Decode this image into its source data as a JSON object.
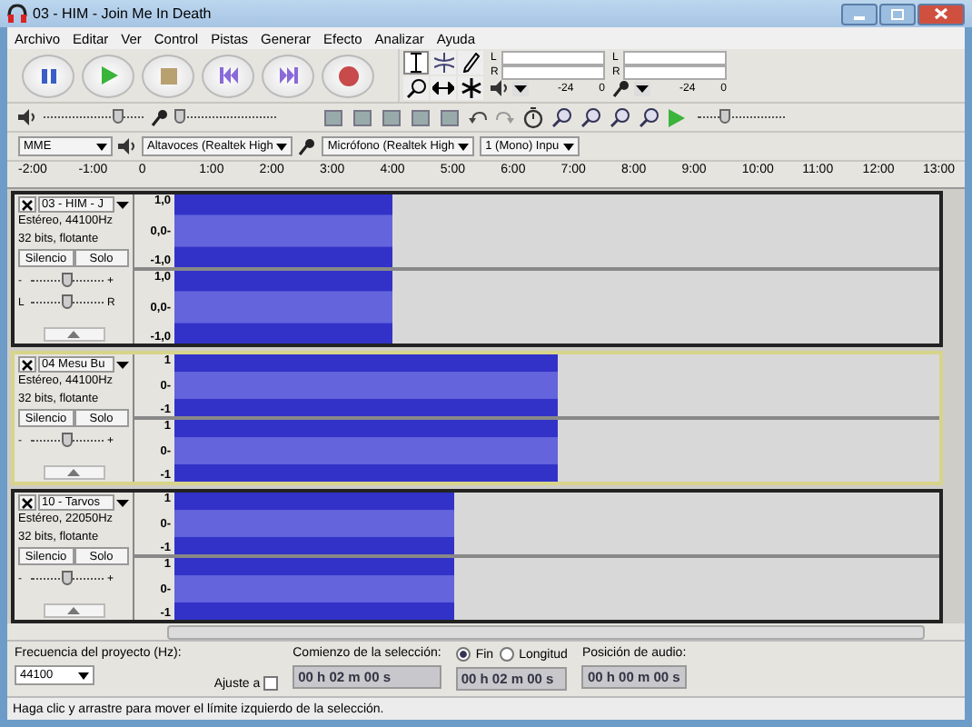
{
  "window": {
    "title": "03 - HIM - Join Me In Death"
  },
  "menu": [
    "Archivo",
    "Editar",
    "Ver",
    "Control",
    "Pistas",
    "Generar",
    "Efecto",
    "Analizar",
    "Ayuda"
  ],
  "meters": [
    {
      "channels": [
        "L",
        "R"
      ],
      "scale": [
        "-24",
        "0"
      ]
    },
    {
      "channels": [
        "L",
        "R"
      ],
      "scale": [
        "-24",
        "0"
      ]
    }
  ],
  "mixer": {
    "output": {
      "level": 0.74
    },
    "input": {
      "level": 0.04
    }
  },
  "play_speed": {
    "level": 0.32
  },
  "devices": {
    "host": "MME",
    "output": "Altavoces (Realtek High",
    "input": "Micrófono (Realtek High",
    "channels": "1 (Mono) Inpu"
  },
  "ruler": [
    "-2:00",
    "-1:00",
    "0",
    "1:00",
    "2:00",
    "3:00",
    "4:00",
    "5:00",
    "6:00",
    "7:00",
    "8:00",
    "9:00",
    "10:00",
    "11:00",
    "12:00",
    "13:00"
  ],
  "tracks": [
    {
      "name": "03 - HIM - J",
      "format": "Estéreo, 44100Hz",
      "bits": "32 bits, flotante",
      "mute": "Silencio",
      "solo": "Solo",
      "selected": false,
      "gain": {
        "labels": [
          "-",
          "+"
        ],
        "level": 0.5
      },
      "pan": {
        "labels": [
          "L",
          "R"
        ],
        "level": 0.5
      },
      "channels": [
        [
          "1,0",
          "0,0-",
          "-1,0"
        ],
        [
          "1,0",
          "0,0-",
          "-1,0"
        ]
      ]
    },
    {
      "name": "04 Mesu Bu",
      "format": "Estéreo, 44100Hz",
      "bits": "32 bits, flotante",
      "mute": "Silencio",
      "solo": "Solo",
      "selected": true,
      "gain": {
        "labels": [
          "-",
          "+"
        ],
        "level": 0.5
      },
      "channels": [
        [
          "1",
          "0-",
          "-1"
        ],
        [
          "1",
          "0-",
          "-1"
        ]
      ]
    },
    {
      "name": "10 - Tarvos",
      "format": "Estéreo, 22050Hz",
      "bits": "32 bits, flotante",
      "mute": "Silencio",
      "solo": "Solo",
      "selected": false,
      "gain": {
        "labels": [
          "-",
          "+"
        ],
        "level": 0.5
      },
      "channels": [
        [
          "1",
          "0-",
          "-1"
        ],
        [
          "1",
          "0-",
          "-1"
        ]
      ]
    }
  ],
  "selection_bar": {
    "rate_label": "Frecuencia del proyecto (Hz):",
    "rate": "44100",
    "snap_label": "Ajuste a",
    "snap_checked": false,
    "start_label": "Comienzo de la selección:",
    "end_options": [
      {
        "label": "Fin",
        "selected": true
      },
      {
        "label": "Longitud",
        "selected": false
      }
    ],
    "start": "00 h 02 m 00 s",
    "end": "00 h 02 m 00 s",
    "position_label": "Posición de audio:",
    "position": "00 h 00 m 00 s"
  },
  "status": "Haga clic y arrastre para mover el límite izquierdo de la selección."
}
